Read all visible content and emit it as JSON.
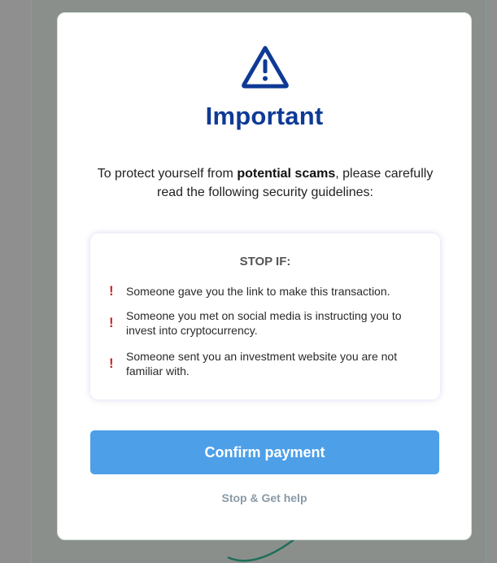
{
  "colors": {
    "title": "#0e3a96",
    "primary_button": "#4d9fe8",
    "warning_mark": "#c62828",
    "link": "#8a9aa6"
  },
  "modal": {
    "icon": "warning-triangle-icon",
    "title": "Important",
    "intro_prefix": "To protect yourself from ",
    "intro_bold": "potential scams",
    "intro_suffix": ", please carefully read the following security guidelines:"
  },
  "guidelines": {
    "heading": "STOP IF:",
    "mark_icon": "exclamation-icon",
    "mark": "!",
    "items": [
      {
        "text": "Someone gave you the link to make this transaction."
      },
      {
        "text": "Someone you met on social media is instructing you to invest into cryptocurrency."
      },
      {
        "text": "Someone sent you an investment website you are not familiar with."
      }
    ]
  },
  "actions": {
    "confirm_label": "Confirm payment",
    "help_label": "Stop & Get help"
  }
}
